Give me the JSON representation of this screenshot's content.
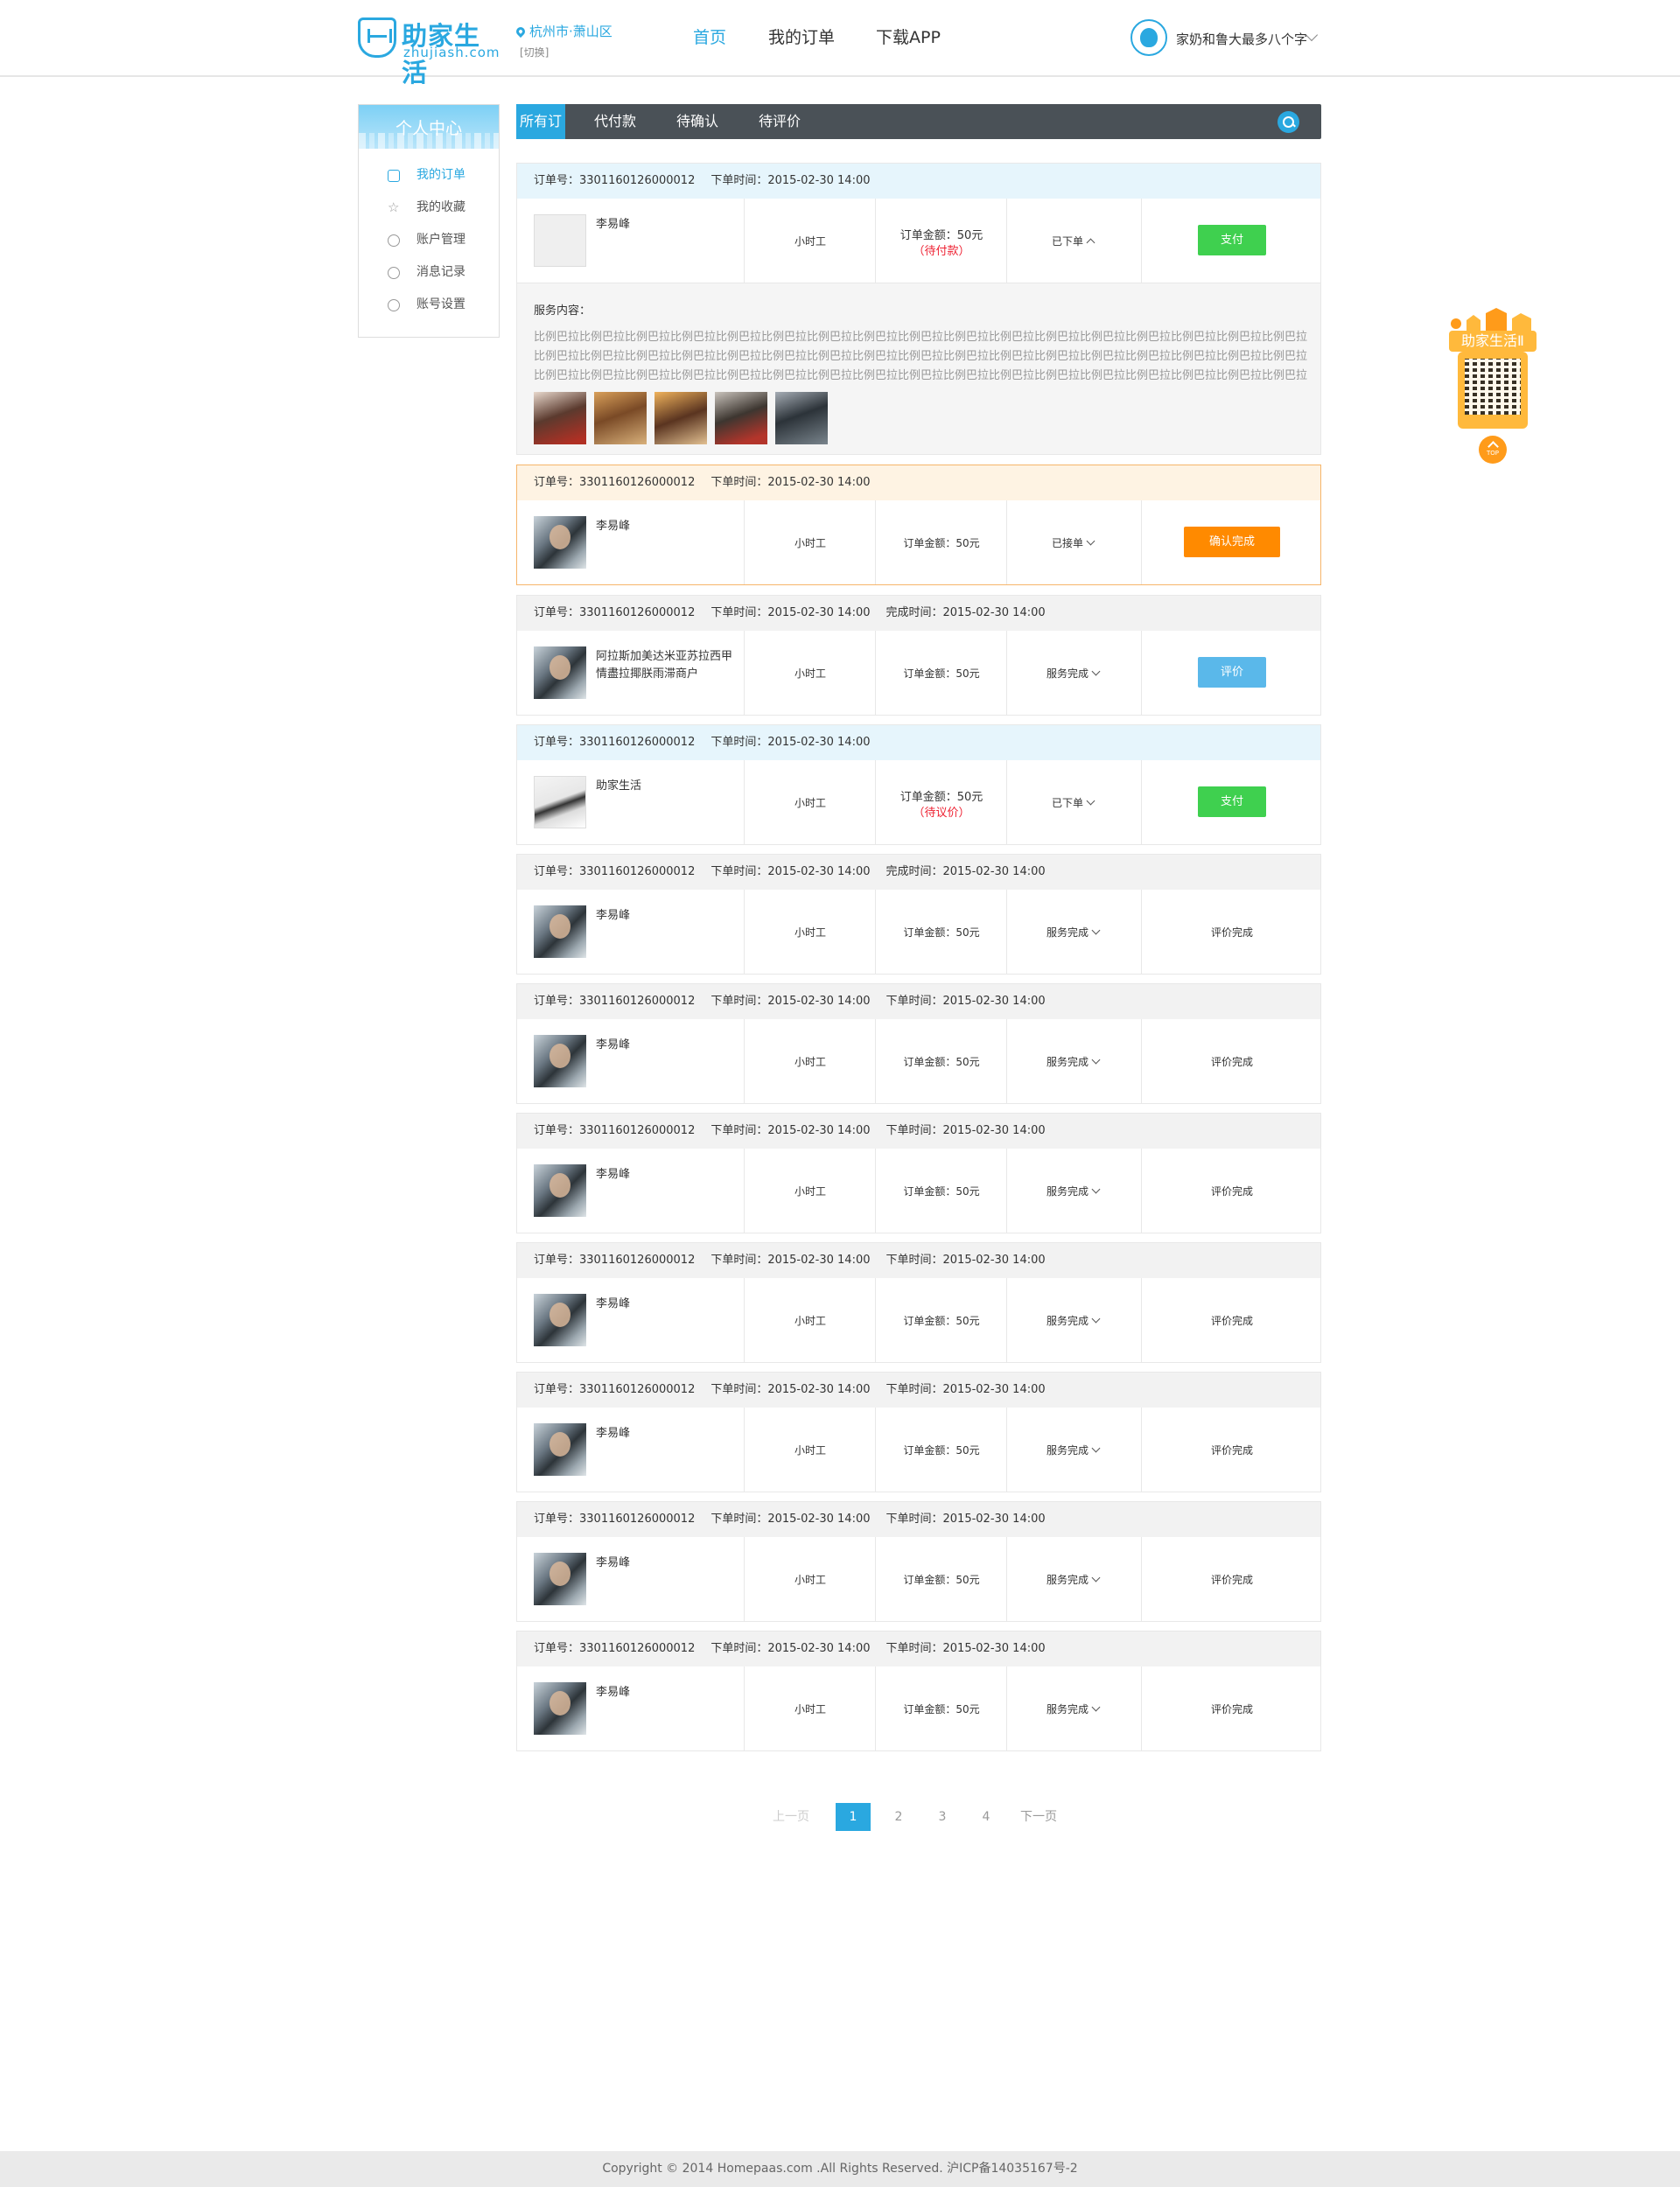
{
  "header": {
    "logo_text": "助家生活",
    "logo_sub": "zhujiash.com",
    "location": "杭州市·萧山区",
    "location_switch": "[切换]",
    "nav": [
      "首页",
      "我的订单",
      "下载APP"
    ],
    "user_name": "家奶和鲁大最多八个字"
  },
  "sidebar": {
    "title": "个人中心",
    "items": [
      "我的订单",
      "我的收藏",
      "账户管理",
      "消息记录",
      "账号设置"
    ]
  },
  "tabs": [
    "所有订单",
    "代付款",
    "待确认",
    "待评价"
  ],
  "orders": [
    {
      "no": "订单号：3301160126000012",
      "time": "下单时间：2015-02-30  14:00",
      "extra": "",
      "name": "李易峰",
      "type": "小时工",
      "price": "订单金额：50元",
      "price_sub": "（待付款）",
      "status": "已下单",
      "action": "支付"
    },
    {
      "no": "订单号：3301160126000012",
      "time": "下单时间：2015-02-30  14:00",
      "extra": "",
      "name": "李易峰",
      "type": "小时工",
      "price": "订单金额：50元",
      "price_sub": "",
      "status": "已接单",
      "action": "确认完成"
    },
    {
      "no": "订单号：3301160126000012",
      "time": "下单时间：2015-02-30  14:00",
      "extra": "完成时间：2015-02-30  14:00",
      "name": "阿拉斯加美达米亚苏拉西甲情盡拉揶朕雨滞商户",
      "type": "小时工",
      "price": "订单金额：50元",
      "price_sub": "",
      "status": "服务完成",
      "action": "评价"
    },
    {
      "no": "订单号：3301160126000012",
      "time": "下单时间：2015-02-30  14:00",
      "extra": "",
      "name": "助家生活",
      "type": "小时工",
      "price": "订单金额：50元",
      "price_sub": "（待议价）",
      "status": "已下单",
      "action": "支付"
    },
    {
      "no": "订单号：3301160126000012",
      "time": "下单时间：2015-02-30  14:00",
      "extra": "完成时间：2015-02-30  14:00",
      "name": "李易峰",
      "type": "小时工",
      "price": "订单金额：50元",
      "price_sub": "",
      "status": "服务完成",
      "action": "评价完成"
    },
    {
      "no": "订单号：3301160126000012",
      "time": "下单时间：2015-02-30  14:00",
      "extra": "下单时间：2015-02-30  14:00",
      "name": "李易峰",
      "type": "小时工",
      "price": "订单金额：50元",
      "price_sub": "",
      "status": "服务完成",
      "action": "评价完成"
    },
    {
      "no": "订单号：3301160126000012",
      "time": "下单时间：2015-02-30  14:00",
      "extra": "下单时间：2015-02-30  14:00",
      "name": "李易峰",
      "type": "小时工",
      "price": "订单金额：50元",
      "price_sub": "",
      "status": "服务完成",
      "action": "评价完成"
    },
    {
      "no": "订单号：3301160126000012",
      "time": "下单时间：2015-02-30  14:00",
      "extra": "下单时间：2015-02-30  14:00",
      "name": "李易峰",
      "type": "小时工",
      "price": "订单金额：50元",
      "price_sub": "",
      "status": "服务完成",
      "action": "评价完成"
    },
    {
      "no": "订单号：3301160126000012",
      "time": "下单时间：2015-02-30  14:00",
      "extra": "下单时间：2015-02-30  14:00",
      "name": "李易峰",
      "type": "小时工",
      "price": "订单金额：50元",
      "price_sub": "",
      "status": "服务完成",
      "action": "评价完成"
    },
    {
      "no": "订单号：3301160126000012",
      "time": "下单时间：2015-02-30  14:00",
      "extra": "下单时间：2015-02-30  14:00",
      "name": "李易峰",
      "type": "小时工",
      "price": "订单金额：50元",
      "price_sub": "",
      "status": "服务完成",
      "action": "评价完成"
    },
    {
      "no": "订单号：3301160126000012",
      "time": "下单时间：2015-02-30  14:00",
      "extra": "下单时间：2015-02-30  14:00",
      "name": "李易峰",
      "type": "小时工",
      "price": "订单金额：50元",
      "price_sub": "",
      "status": "服务完成",
      "action": "评价完成"
    }
  ],
  "detail": {
    "label": "服务内容：",
    "text": "比例巴拉比例巴拉比例巴拉比例巴拉比例巴拉比例巴拉比例巴拉比例巴拉比例巴拉比例巴拉比例巴拉比例巴拉比例巴拉比例巴拉比例巴拉比例巴拉比例巴拉比例巴拉比例巴拉比例巴拉比例巴拉比例巴拉比例巴拉比例巴拉比例巴拉比例巴拉比例巴拉比例巴拉比例巴拉比例巴拉比例巴拉比例巴拉比例巴拉比例巴拉比例巴拉比例巴拉比例巴拉比例巴拉比例巴拉比例巴拉比例巴拉比例巴拉比例巴拉比例巴拉比例巴拉比例巴拉比例巴拉比例巴拉比例巴拉比例巴拉比例巴拉比例巴拉比例巴拉比例巴拉比例巴"
  },
  "pagination": {
    "prev": "上一页",
    "pages": [
      "1",
      "2",
      "3",
      "4"
    ],
    "next": "下一页",
    "current": "1"
  },
  "float": {
    "sign": "助家生活Ⅱ",
    "top": "TOP"
  },
  "footer": "Copyright © 2014 Homepaas.com .All Rights Reserved. 沪ICP备14035167号-2"
}
